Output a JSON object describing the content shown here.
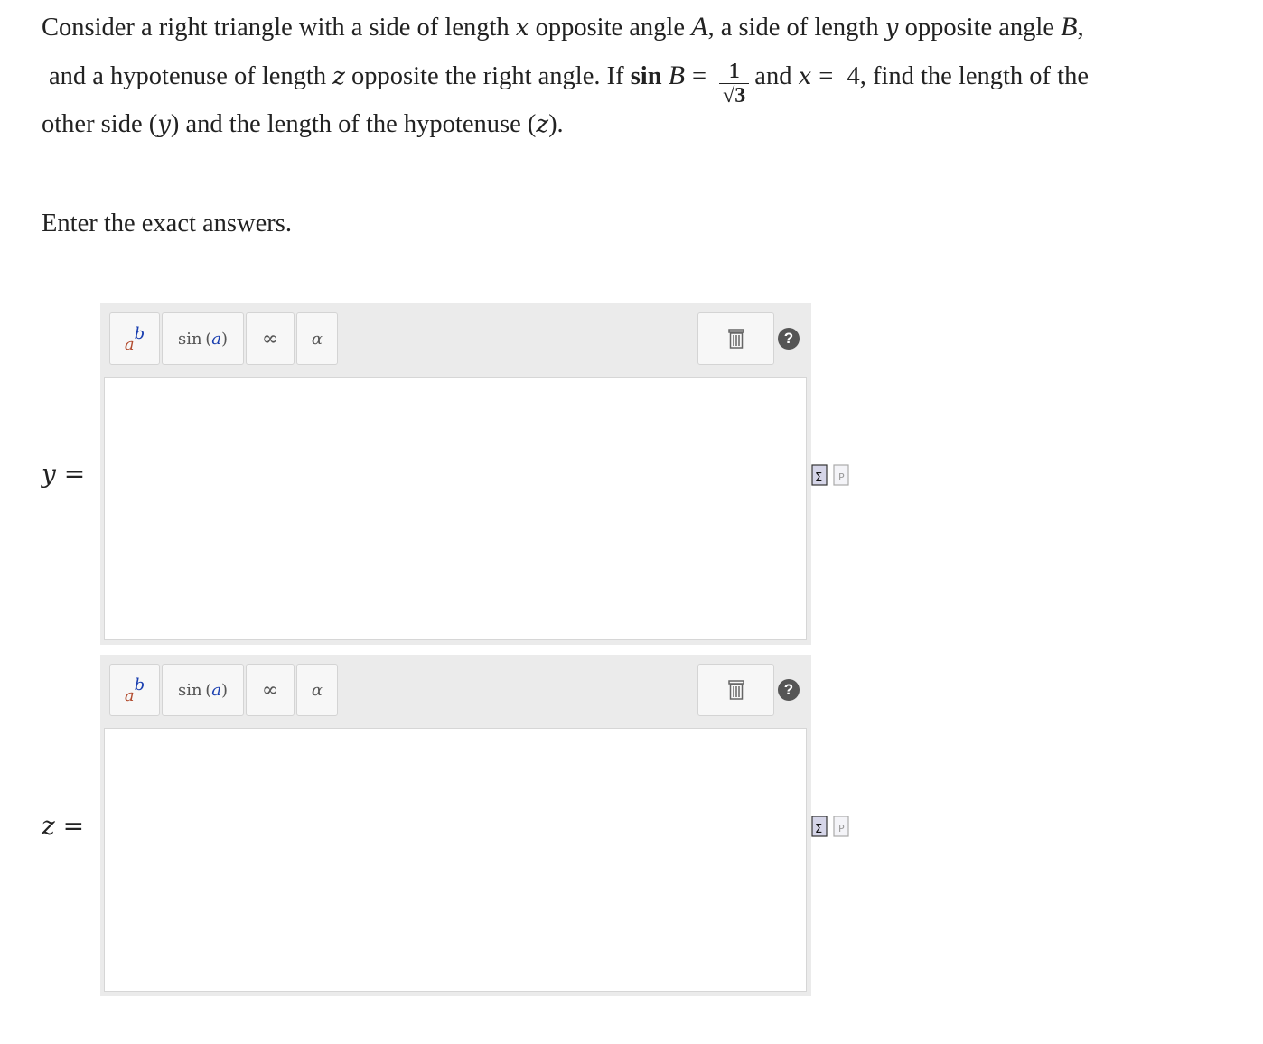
{
  "problem": {
    "l1_a": "Consider a right triangle with a side of length ",
    "x1": "x",
    "l1_b": " opposite angle ",
    "A": "A",
    "l1_c": ", a side of length ",
    "y1": "y",
    "l1_d": " opposite angle ",
    "B": "B",
    "l1_e": ",",
    "l2_a": "and a hypotenuse of length ",
    "z1": "z",
    "l2_b": " opposite the right angle. If ",
    "sin": "sin",
    "B2": "B",
    "eq": "=",
    "frac_num": "1",
    "frac_den": "√3",
    "l2_c": "and ",
    "x2": "x",
    "eq2": "=",
    "l2_d": " 4, find the length of the",
    "l3_a": "other side (",
    "y2": "y",
    "l3_b": ") and the length of the hypotenuse (",
    "z2": "z",
    "l3_c": ")."
  },
  "instruction": "Enter the exact answers.",
  "answers": [
    {
      "var": "y",
      "eq": "="
    },
    {
      "var": "z",
      "eq": "="
    }
  ],
  "toolbar": {
    "pow_base": "a",
    "pow_exp": "b",
    "sin_fn": "sin",
    "sin_arg": "a",
    "infinity": "∞",
    "alpha": "α",
    "help": "?"
  },
  "icons": {
    "trash": "trash-icon",
    "help": "help-icon",
    "equation": "equation-editor-icon",
    "preview": "preview-icon"
  }
}
